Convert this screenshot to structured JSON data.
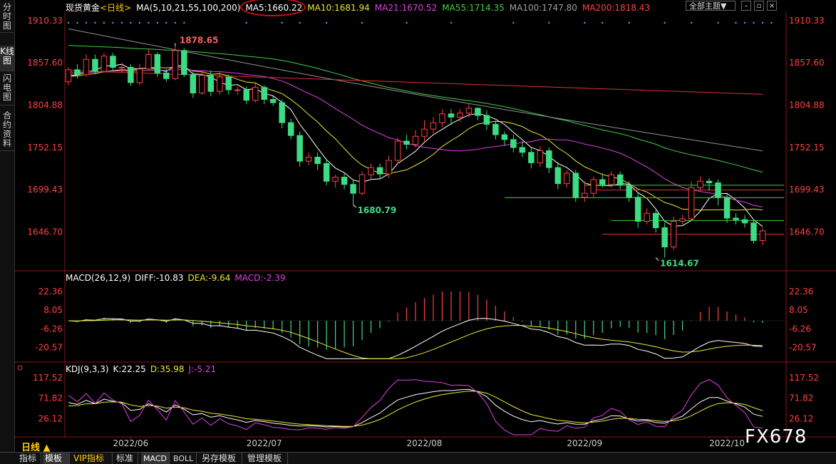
{
  "sidebar": {
    "items": [
      {
        "label": "分时图",
        "active": false
      },
      {
        "label": "K线图",
        "active": true
      },
      {
        "label": "闪电图",
        "active": false
      },
      {
        "label": "合约资料",
        "active": false
      }
    ]
  },
  "header": {
    "symbol": "现货黄金",
    "period": "<日线>",
    "ma_group": "MA(5,10,21,55,100,200)",
    "ma5": "MA5:1660.22",
    "ma10": "MA10:1681.94",
    "ma21": "MA21:1670.52",
    "ma55": "MA55:1714.35",
    "ma100": "MA100:1747.80",
    "ma200": "MA200:1818.43",
    "theme_button": "全部主题▼",
    "icons": [
      "minus-icon",
      "restore-icon",
      "close-icon"
    ]
  },
  "colors": {
    "up": "#ff4040",
    "down": "#3ddc84",
    "ma5": "#ffffff",
    "ma10": "#e8e830",
    "ma21": "#e040e0",
    "ma55": "#40d040",
    "ma100": "#909090",
    "ma200": "#e03030",
    "axis": "#ff4040",
    "accent": "#ffcc00"
  },
  "chart_data": [
    {
      "type": "candlestick",
      "y_ticks": [
        "1910.33",
        "1857.60",
        "1804.88",
        "1752.15",
        "1699.43",
        "1646.70"
      ],
      "ylim": [
        1600,
        1920
      ],
      "x_labels": [
        "2022/06",
        "2022/07",
        "2022/08",
        "2022/09",
        "2022/10"
      ],
      "annotations": [
        {
          "text": "1878.65",
          "value": 1878.65,
          "index": 12
        },
        {
          "text": "1680.79",
          "value": 1680.79,
          "index": 32
        },
        {
          "text": "1614.67",
          "value": 1614.67,
          "index": 66
        }
      ],
      "horizontal_lines": [
        {
          "value": 1705.0,
          "color": "#40d040"
        },
        {
          "value": 1699.0,
          "color": "#e03030"
        },
        {
          "value": 1689.5,
          "color": "#40d040"
        },
        {
          "value": 1661.0,
          "color": "#40d040"
        },
        {
          "value": 1644.0,
          "color": "#e03030"
        }
      ],
      "candles": [
        [
          1834,
          1849,
          1830,
          1852
        ],
        [
          1849,
          1843,
          1838,
          1856
        ],
        [
          1843,
          1862,
          1840,
          1868
        ],
        [
          1862,
          1847,
          1844,
          1868
        ],
        [
          1847,
          1866,
          1845,
          1870
        ],
        [
          1866,
          1852,
          1848,
          1870
        ],
        [
          1852,
          1852,
          1846,
          1858
        ],
        [
          1852,
          1833,
          1829,
          1856
        ],
        [
          1833,
          1850,
          1830,
          1856
        ],
        [
          1850,
          1868,
          1848,
          1875
        ],
        [
          1868,
          1845,
          1840,
          1871
        ],
        [
          1845,
          1838,
          1834,
          1850
        ],
        [
          1838,
          1873,
          1836,
          1878.65
        ],
        [
          1873,
          1843,
          1840,
          1876
        ],
        [
          1843,
          1820,
          1814,
          1846
        ],
        [
          1820,
          1842,
          1818,
          1846
        ],
        [
          1842,
          1822,
          1816,
          1848
        ],
        [
          1822,
          1840,
          1818,
          1846
        ],
        [
          1840,
          1824,
          1818,
          1843
        ],
        [
          1824,
          1824,
          1818,
          1828
        ],
        [
          1824,
          1811,
          1806,
          1828
        ],
        [
          1811,
          1827,
          1808,
          1832
        ],
        [
          1827,
          1812,
          1806,
          1830
        ],
        [
          1812,
          1808,
          1804,
          1816
        ],
        [
          1808,
          1783,
          1776,
          1812
        ],
        [
          1783,
          1767,
          1762,
          1788
        ],
        [
          1767,
          1735,
          1728,
          1772
        ],
        [
          1735,
          1740,
          1730,
          1746
        ],
        [
          1740,
          1732,
          1724,
          1746
        ],
        [
          1732,
          1710,
          1705,
          1738
        ],
        [
          1710,
          1715,
          1702,
          1718
        ],
        [
          1715,
          1706,
          1700,
          1720
        ],
        [
          1706,
          1695,
          1680.79,
          1712
        ],
        [
          1695,
          1718,
          1692,
          1722
        ],
        [
          1718,
          1727,
          1712,
          1732
        ],
        [
          1727,
          1719,
          1712,
          1732
        ],
        [
          1719,
          1736,
          1714,
          1742
        ],
        [
          1736,
          1760,
          1732,
          1764
        ],
        [
          1760,
          1756,
          1750,
          1768
        ],
        [
          1756,
          1766,
          1752,
          1774
        ],
        [
          1766,
          1775,
          1760,
          1786
        ],
        [
          1775,
          1783,
          1770,
          1790
        ],
        [
          1783,
          1794,
          1778,
          1800
        ],
        [
          1794,
          1790,
          1780,
          1800
        ],
        [
          1790,
          1795,
          1784,
          1800
        ],
        [
          1795,
          1801,
          1790,
          1806
        ],
        [
          1801,
          1792,
          1786,
          1802
        ],
        [
          1792,
          1781,
          1774,
          1798
        ],
        [
          1781,
          1768,
          1762,
          1786
        ],
        [
          1768,
          1762,
          1754,
          1772
        ],
        [
          1762,
          1752,
          1746,
          1768
        ],
        [
          1752,
          1746,
          1740,
          1760
        ],
        [
          1746,
          1733,
          1726,
          1752
        ],
        [
          1733,
          1748,
          1728,
          1754
        ],
        [
          1748,
          1727,
          1720,
          1752
        ],
        [
          1727,
          1707,
          1700,
          1734
        ],
        [
          1707,
          1720,
          1702,
          1724
        ],
        [
          1720,
          1690,
          1684,
          1724
        ],
        [
          1690,
          1695,
          1684,
          1710
        ],
        [
          1695,
          1712,
          1690,
          1716
        ],
        [
          1712,
          1706,
          1702,
          1720
        ],
        [
          1706,
          1718,
          1702,
          1722
        ],
        [
          1718,
          1705,
          1700,
          1722
        ],
        [
          1705,
          1690,
          1684,
          1710
        ],
        [
          1690,
          1660,
          1652,
          1696
        ],
        [
          1660,
          1670,
          1656,
          1676
        ],
        [
          1670,
          1652,
          1646,
          1674
        ],
        [
          1652,
          1628,
          1614.67,
          1658
        ],
        [
          1628,
          1660,
          1624,
          1666
        ],
        [
          1660,
          1663,
          1656,
          1668
        ],
        [
          1663,
          1702,
          1660,
          1710
        ],
        [
          1702,
          1710,
          1698,
          1716
        ],
        [
          1710,
          1708,
          1698,
          1714
        ],
        [
          1708,
          1690,
          1680,
          1712
        ],
        [
          1690,
          1664,
          1658,
          1694
        ],
        [
          1664,
          1662,
          1656,
          1670
        ],
        [
          1662,
          1658,
          1652,
          1668
        ],
        [
          1658,
          1636,
          1632,
          1662
        ],
        [
          1636,
          1648,
          1630,
          1652
        ]
      ]
    },
    {
      "type": "bar",
      "name": "MACD(26,12,9)",
      "title": "MACD(26,12,9)",
      "diff_label": "DIFF:-10.83",
      "dea_label": "DEA:-9.64",
      "macd_label": "MACD:-2.39",
      "y_ticks": [
        "22.36",
        "8.05",
        "-6.26",
        "-20.57"
      ],
      "ylim": [
        -30,
        30
      ]
    },
    {
      "type": "line",
      "name": "KDJ(9,3,3)",
      "title": "KDJ(9,3,3)",
      "k_label": "K:22.25",
      "d_label": "D:35.98",
      "j_label": "J:-5.21",
      "y_ticks": [
        "117.52",
        "71.82",
        "26.12"
      ],
      "ylim": [
        -10,
        130
      ]
    }
  ],
  "bottombar": {
    "period": "日线 ▲",
    "tabs": [
      {
        "label": "指标",
        "active": false
      },
      {
        "label": "模板",
        "active": true
      },
      {
        "label": "VIP指标",
        "active": false,
        "color": "#ffcc00"
      },
      {
        "label": "标准",
        "active": false
      },
      {
        "label": "MACD",
        "active": true
      },
      {
        "label": "BOLL",
        "active": false
      },
      {
        "label": "另存模板",
        "active": false
      },
      {
        "label": "管理模板",
        "active": false
      }
    ]
  },
  "watermark": "FX678"
}
